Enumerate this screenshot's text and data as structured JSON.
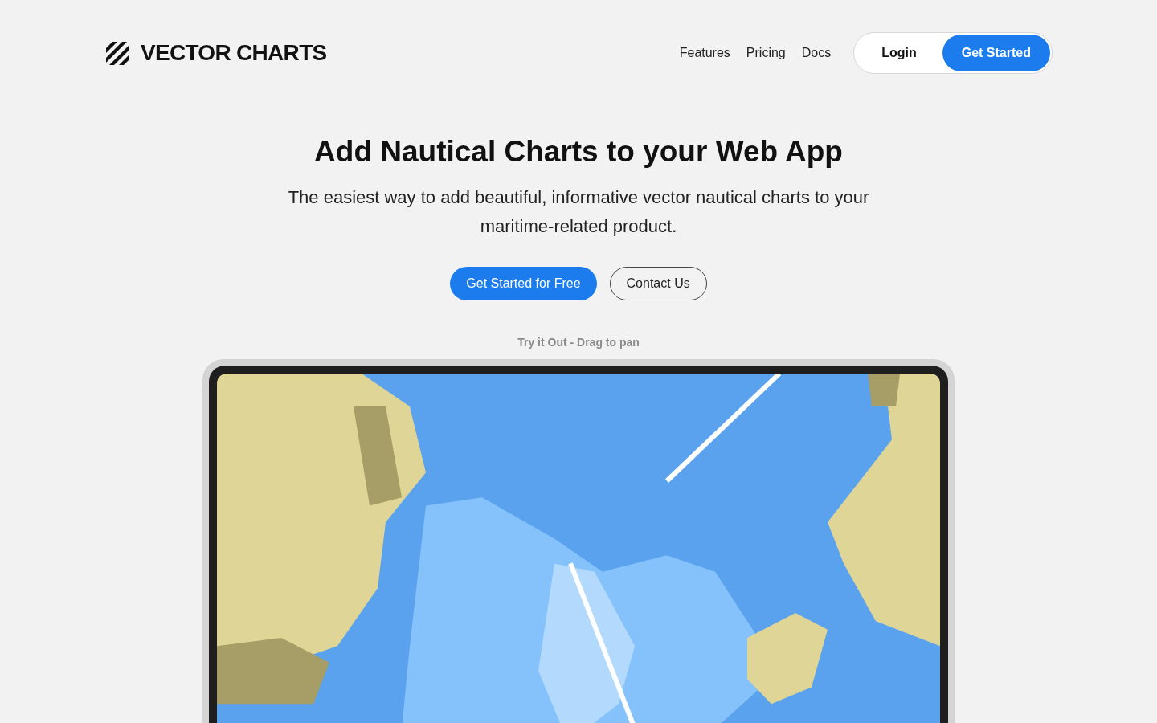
{
  "brand": {
    "name": "VECTOR CHARTS"
  },
  "nav": {
    "links": [
      "Features",
      "Pricing",
      "Docs"
    ],
    "login": "Login",
    "cta": "Get Started"
  },
  "hero": {
    "title": "Add Nautical Charts to your Web App",
    "subtitle": "The easiest way to add beautiful, informative vector nautical charts to your maritime-related product.",
    "primary_button": "Get Started for Free",
    "secondary_button": "Contact Us"
  },
  "demo": {
    "caption": "Try it Out - Drag to pan"
  }
}
